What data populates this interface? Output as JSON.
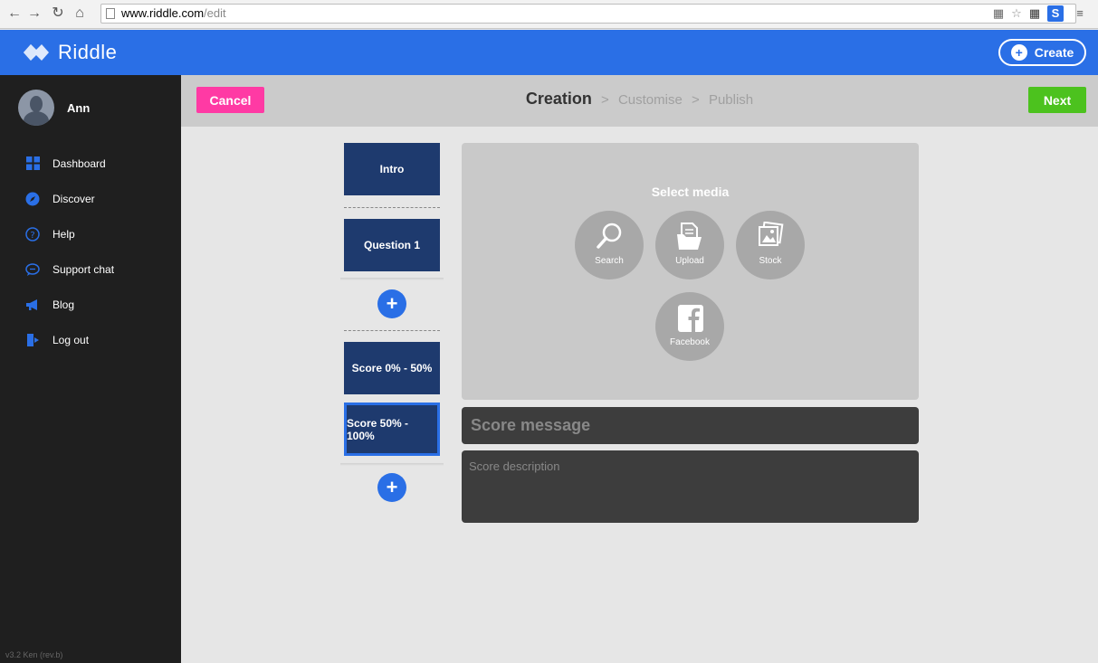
{
  "browser": {
    "url_host": "www.riddle.com",
    "url_path": "/edit",
    "ext_s_label": "S"
  },
  "header": {
    "logo_text": "Riddle",
    "create_label": "Create"
  },
  "sidebar": {
    "username": "Ann",
    "items": [
      {
        "label": "Dashboard",
        "icon": "dashboard-icon"
      },
      {
        "label": "Discover",
        "icon": "compass-icon"
      },
      {
        "label": "Help",
        "icon": "help-icon"
      },
      {
        "label": "Support chat",
        "icon": "chat-icon"
      },
      {
        "label": "Blog",
        "icon": "megaphone-icon"
      },
      {
        "label": "Log out",
        "icon": "logout-icon"
      }
    ],
    "version": "v3.2 Ken (rev.b)"
  },
  "stepbar": {
    "cancel_label": "Cancel",
    "next_label": "Next",
    "steps": [
      "Creation",
      "Customise",
      "Publish"
    ],
    "separator": ">"
  },
  "cards": {
    "intro": "Intro",
    "question1": "Question 1",
    "score_low": "Score 0% - 50%",
    "score_high": "Score 50% - 100%",
    "add_symbol": "+"
  },
  "media": {
    "title": "Select media",
    "search_label": "Search",
    "upload_label": "Upload",
    "stock_label": "Stock",
    "facebook_label": "Facebook"
  },
  "score": {
    "message_placeholder": "Score message",
    "description_placeholder": "Score description"
  },
  "colors": {
    "brand_blue": "#2a6fe6",
    "cancel_pink": "#ff3aa4",
    "next_green": "#4cc21e",
    "card_navy": "#1e3a6e"
  }
}
